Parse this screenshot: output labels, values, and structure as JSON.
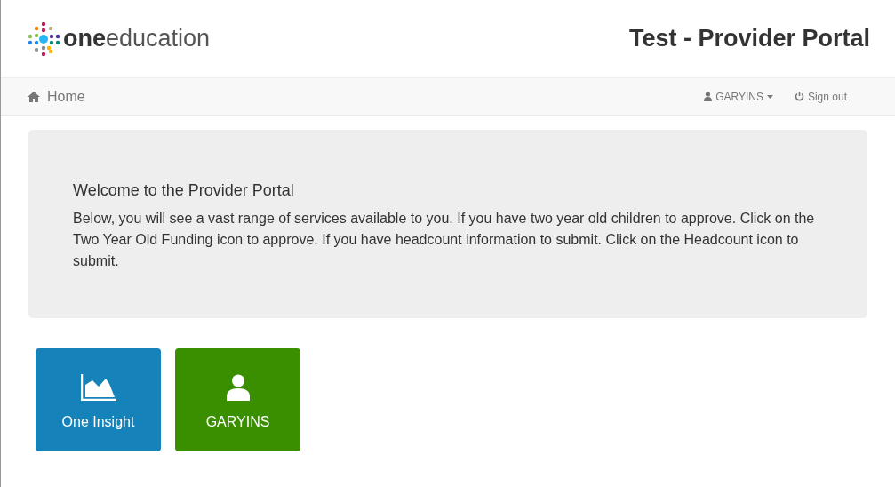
{
  "logo": {
    "text": "**one**education"
  },
  "header": {
    "title": "Test - Provider Portal"
  },
  "navbar": {
    "home": "Home",
    "user": "GARYINS",
    "sign_out": "Sign out"
  },
  "welcome": {
    "heading": "Welcome to the Provider Portal",
    "text": "Below, you will see a vast range of services available to you. If you have two year old children to approve. Click on the Two Year Old Funding icon to approve. If you have headcount information to submit. Click on the Headcount icon to submit."
  },
  "tiles": [
    {
      "label": "One Insight",
      "kind": "chart",
      "color": "#1582b9"
    },
    {
      "label": "GARYINS",
      "kind": "user",
      "color": "#3a8f00"
    }
  ]
}
